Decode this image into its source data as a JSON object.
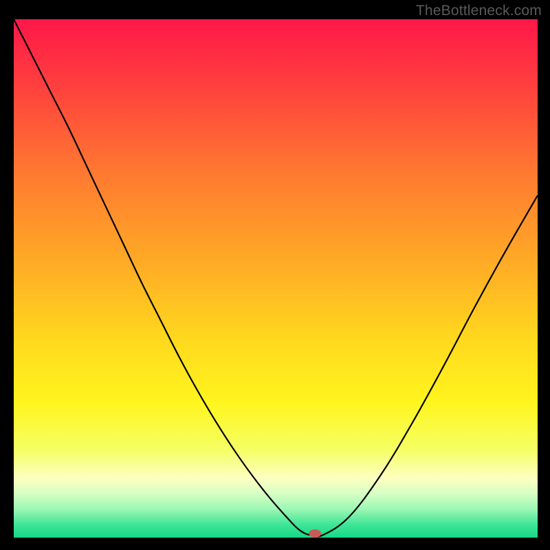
{
  "watermark": {
    "text": "TheBottleneck.com"
  },
  "chart_data": {
    "type": "line",
    "title": "",
    "xlabel": "",
    "ylabel": "",
    "xlim": [
      0,
      100
    ],
    "ylim": [
      0,
      100
    ],
    "grid": false,
    "legend": false,
    "series": [
      {
        "name": "bottleneck-curve",
        "x": [
          0,
          3.5,
          7,
          10.5,
          14,
          17.5,
          21,
          24.5,
          28,
          31.5,
          35,
          38.5,
          42,
          45.5,
          49,
          52.5,
          54.5,
          56.5,
          59,
          64,
          70,
          76,
          82,
          88,
          94,
          100
        ],
        "y": [
          100,
          93,
          86,
          79,
          71.5,
          64,
          56.5,
          49,
          42,
          35,
          28.5,
          22.5,
          17,
          12,
          7.5,
          3.5,
          1.5,
          0.5,
          0.5,
          4,
          12,
          22,
          33,
          44.5,
          55.5,
          66
        ],
        "color": "#000000",
        "width": 2.2
      }
    ],
    "marker": {
      "name": "bottleneck-point",
      "x": 57.5,
      "y": 0.8,
      "color": "#c95b56",
      "rx": 9,
      "ry": 6
    },
    "background_gradient": {
      "stops": [
        {
          "offset": 0.0,
          "color": "#ff1749"
        },
        {
          "offset": 0.12,
          "color": "#ff3d3f"
        },
        {
          "offset": 0.3,
          "color": "#ff7a30"
        },
        {
          "offset": 0.48,
          "color": "#ffae25"
        },
        {
          "offset": 0.62,
          "color": "#ffd91e"
        },
        {
          "offset": 0.74,
          "color": "#fff51e"
        },
        {
          "offset": 0.83,
          "color": "#f5ff63"
        },
        {
          "offset": 0.885,
          "color": "#fdffc0"
        },
        {
          "offset": 0.915,
          "color": "#d7ffc4"
        },
        {
          "offset": 0.945,
          "color": "#9cf7b4"
        },
        {
          "offset": 0.975,
          "color": "#3fe596"
        },
        {
          "offset": 1.0,
          "color": "#15d987"
        }
      ]
    }
  }
}
